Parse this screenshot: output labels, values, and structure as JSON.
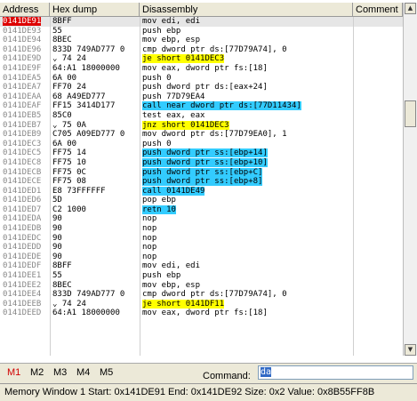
{
  "columns": [
    "Address",
    "Hex dump",
    "Disassembly",
    "Comment"
  ],
  "rows": [
    {
      "addr": "0141DE91",
      "hex": "8BFF",
      "mn": "mov edi, edi",
      "sel": true
    },
    {
      "addr": "0141DE93",
      "hex": "55",
      "mn": "push ebp"
    },
    {
      "addr": "0141DE94",
      "hex": "8BEC",
      "mn": "mov ebp, esp"
    },
    {
      "addr": "0141DE96",
      "hex": "833D 749AD777 0",
      "mn": "cmp dword ptr ds:[77D79A74], 0"
    },
    {
      "addr": "0141DE9D",
      "arrow": "v",
      "hex": "74 24",
      "mn": "je short 0141DEC3",
      "hl": "yel"
    },
    {
      "addr": "0141DE9F",
      "hex": "64:A1 18000000",
      "mn": "mov eax, dword ptr fs:[18]"
    },
    {
      "addr": "0141DEA5",
      "hex": "6A 00",
      "mn": "push 0"
    },
    {
      "addr": "0141DEA7",
      "hex": "FF70 24",
      "mn": "push dword ptr ds:[eax+24]"
    },
    {
      "addr": "0141DEAA",
      "hex": "68 A49ED777",
      "mn": "push 77D79EA4"
    },
    {
      "addr": "0141DEAF",
      "hex": "FF15 3414D177",
      "mn": "call near dword ptr ds:[77D11434]",
      "hl": "cyan"
    },
    {
      "addr": "0141DEB5",
      "hex": "85C0",
      "mn": "test eax, eax"
    },
    {
      "addr": "0141DEB7",
      "arrow": "v",
      "hex": "75 0A",
      "mn": "jnz short 0141DEC3",
      "hl": "yel"
    },
    {
      "addr": "0141DEB9",
      "hex": "C705 A09ED777 0",
      "mn": "mov dword ptr ds:[77D79EA0], 1"
    },
    {
      "addr": "0141DEC3",
      "hex": "6A 00",
      "mn": "push 0"
    },
    {
      "addr": "0141DEC5",
      "hex": "FF75 14",
      "mn": "push dword ptr ss:[ebp+14]",
      "hl": "cyan"
    },
    {
      "addr": "0141DEC8",
      "hex": "FF75 10",
      "mn": "push dword ptr ss:[ebp+10]",
      "hl": "cyan"
    },
    {
      "addr": "0141DECB",
      "hex": "FF75 0C",
      "mn": "push dword ptr ss:[ebp+C]",
      "hl": "cyan"
    },
    {
      "addr": "0141DECE",
      "hex": "FF75 08",
      "mn": "push dword ptr ss:[ebp+8]",
      "hl": "cyan"
    },
    {
      "addr": "0141DED1",
      "hex": "E8 73FFFFFF",
      "mn": "call 0141DE49",
      "hl": "cyan"
    },
    {
      "addr": "0141DED6",
      "hex": "5D",
      "mn": "pop ebp"
    },
    {
      "addr": "0141DED7",
      "hex": "C2 1000",
      "mn": "retn 10",
      "hl": "cyan"
    },
    {
      "addr": "0141DEDA",
      "hex": "90",
      "mn": "nop"
    },
    {
      "addr": "0141DEDB",
      "hex": "90",
      "mn": "nop"
    },
    {
      "addr": "0141DEDC",
      "hex": "90",
      "mn": "nop"
    },
    {
      "addr": "0141DEDD",
      "hex": "90",
      "mn": "nop"
    },
    {
      "addr": "0141DEDE",
      "hex": "90",
      "mn": "nop"
    },
    {
      "addr": "0141DEDF",
      "hex": "8BFF",
      "mn": "mov edi, edi"
    },
    {
      "addr": "0141DEE1",
      "hex": "55",
      "mn": "push ebp"
    },
    {
      "addr": "0141DEE2",
      "hex": "8BEC",
      "mn": "mov ebp, esp"
    },
    {
      "addr": "0141DEE4",
      "hex": "833D 749AD777 0",
      "mn": "cmp dword ptr ds:[77D79A74], 0"
    },
    {
      "addr": "0141DEEB",
      "arrow": "v",
      "hex": "74 24",
      "mn": "je short 0141DF11",
      "hl": "yel"
    },
    {
      "addr": "0141DEED",
      "hex": "64:A1 18000000",
      "mn": "mov eax, dword ptr fs:[18]"
    }
  ],
  "tabs": [
    "M1",
    "M2",
    "M3",
    "M4",
    "M5"
  ],
  "command": {
    "label": "Command:",
    "value": "da"
  },
  "status": "Memory Window 1  Start:  0x141DE91  End:  0x141DE92  Size:  0x2 Value:  0x8B55FF8B",
  "colors": {
    "selected_addr_bg": "#dd0000",
    "jump_highlight": "#ffff00",
    "call_highlight": "#33ccff",
    "active_tab": "#d00000"
  },
  "icons": [
    "scroll-up-icon",
    "scroll-down-icon"
  ]
}
